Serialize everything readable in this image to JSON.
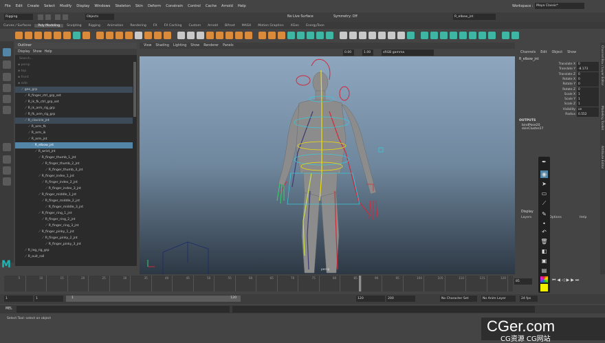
{
  "menu": [
    "File",
    "Edit",
    "Create",
    "Select",
    "Modify",
    "Display",
    "Windows",
    "Skeleton",
    "Skin",
    "Deform",
    "Constrain",
    "Control",
    "Cache",
    "Arnold",
    "Help"
  ],
  "workspace": {
    "label": "Workspace :",
    "value": "Maya Classic*"
  },
  "status": {
    "mode": "Rigging",
    "objects": "Objects",
    "live": "No Live Surface",
    "symmetry": "Symmetry: Off",
    "selected_name": "R_elbow_jnt"
  },
  "shelf_tabs": [
    "Curves / Surfaces",
    "Poly Modeling",
    "Sculpting",
    "Rigging",
    "Animation",
    "Rendering",
    "FX",
    "FX Caching",
    "Custom",
    "Arnold",
    "Bifrost",
    "MASH",
    "Motion Graphics",
    "XGen",
    "EnergyToon"
  ],
  "active_shelf": "Poly Modeling",
  "outliner": {
    "title": "Outliner",
    "menu": [
      "Display",
      "Show",
      "Help"
    ],
    "search": "Search...",
    "rows": [
      {
        "label": "persp",
        "indent": 0,
        "style": "dim"
      },
      {
        "label": "top",
        "indent": 0,
        "style": "dim"
      },
      {
        "label": "front",
        "indent": 0,
        "style": "dim"
      },
      {
        "label": "side",
        "indent": 0,
        "style": "dim"
      },
      {
        "label": "geo_grp",
        "indent": 1,
        "style": "hl"
      },
      {
        "label": "R_finger_ctrl_grp_set",
        "indent": 2,
        "style": ""
      },
      {
        "label": "R_ik_fk_ctrl_grp_set",
        "indent": 2,
        "style": ""
      },
      {
        "label": "R_ik_arm_rig_grp",
        "indent": 2,
        "style": ""
      },
      {
        "label": "R_fk_arm_rig_grp",
        "indent": 2,
        "style": ""
      },
      {
        "label": "R_clavicle_jnt",
        "indent": 2,
        "style": "hl"
      },
      {
        "label": "R_arm_fk",
        "indent": 3,
        "style": ""
      },
      {
        "label": "R_arm_ik",
        "indent": 3,
        "style": ""
      },
      {
        "label": "R_arm_jnt",
        "indent": 3,
        "style": ""
      },
      {
        "label": "R_elbow_jnt",
        "indent": 4,
        "style": "sel"
      },
      {
        "label": "R_wrist_jnt",
        "indent": 5,
        "style": ""
      },
      {
        "label": "R_finger_thumb_1_jnt",
        "indent": 6,
        "style": ""
      },
      {
        "label": "R_finger_thumb_2_jnt",
        "indent": 7,
        "style": ""
      },
      {
        "label": "R_finger_thumb_3_jnt",
        "indent": 8,
        "style": ""
      },
      {
        "label": "R_finger_index_1_jnt",
        "indent": 6,
        "style": ""
      },
      {
        "label": "R_finger_index_2_jnt",
        "indent": 7,
        "style": ""
      },
      {
        "label": "R_finger_index_3_jnt",
        "indent": 8,
        "style": ""
      },
      {
        "label": "R_finger_middle_1_jnt",
        "indent": 6,
        "style": ""
      },
      {
        "label": "R_finger_middle_2_jnt",
        "indent": 7,
        "style": ""
      },
      {
        "label": "R_finger_middle_3_jnt",
        "indent": 8,
        "style": ""
      },
      {
        "label": "R_finger_ring_1_jnt",
        "indent": 6,
        "style": ""
      },
      {
        "label": "R_finger_ring_2_jnt",
        "indent": 7,
        "style": ""
      },
      {
        "label": "R_finger_ring_3_jnt",
        "indent": 8,
        "style": ""
      },
      {
        "label": "R_finger_pinky_1_jnt",
        "indent": 6,
        "style": ""
      },
      {
        "label": "R_finger_pinky_2_jnt",
        "indent": 7,
        "style": ""
      },
      {
        "label": "R_finger_pinky_3_jnt",
        "indent": 8,
        "style": ""
      },
      {
        "label": "R_leg_rig_grp",
        "indent": 2,
        "style": ""
      },
      {
        "label": "R_ouit_roll",
        "indent": 2,
        "style": ""
      }
    ]
  },
  "viewport": {
    "menu": [
      "View",
      "Shading",
      "Lighting",
      "Show",
      "Renderer",
      "Panels"
    ],
    "values": [
      "0.00",
      "1.00"
    ],
    "color_space": "sRGB gamma",
    "camera": "persp"
  },
  "channel_box": {
    "tabs": [
      "Channels",
      "Edit",
      "Object",
      "Show"
    ],
    "node": "R_elbow_jnt",
    "attrs": [
      {
        "name": "Translate X",
        "value": "0"
      },
      {
        "name": "Translate Y",
        "value": "-8.173"
      },
      {
        "name": "Translate Z",
        "value": "0"
      },
      {
        "name": "Rotate X",
        "value": "0"
      },
      {
        "name": "Rotate Y",
        "value": "0"
      },
      {
        "name": "Rotate Z",
        "value": "0"
      },
      {
        "name": "Scale X",
        "value": "1"
      },
      {
        "name": "Scale Y",
        "value": "1"
      },
      {
        "name": "Scale Z",
        "value": "1"
      },
      {
        "name": "Visibility",
        "value": "on"
      },
      {
        "name": "Radius",
        "value": "0.552"
      }
    ],
    "outputs_title": "OUTPUTS",
    "outputs": [
      "bindPose20",
      "skinCluster27"
    ]
  },
  "layers": {
    "title": "Display",
    "menu": [
      "Layers",
      "Options",
      "Help"
    ]
  },
  "side_tabs": [
    "Channel Box / Layer Editor",
    "Modeling Toolkit",
    "Attribute Editor"
  ],
  "timeline": {
    "ticks": [
      "5",
      "10",
      "15",
      "20",
      "25",
      "30",
      "35",
      "40",
      "45",
      "50",
      "55",
      "60",
      "65",
      "70",
      "75",
      "80",
      "85",
      "90",
      "95",
      "100",
      "105",
      "110",
      "115",
      "120"
    ],
    "current": "85"
  },
  "range": {
    "start": "1",
    "inner_start": "1",
    "slider_start": "1",
    "slider_end": "120",
    "end": "120",
    "outer_end": "200",
    "character": "No Character Set",
    "anim_layer": "No Anim Layer",
    "fps": "24 fps"
  },
  "command": {
    "label": "MEL"
  },
  "help_text": "Select Tool: select an object",
  "watermark": {
    "main": "CGer.com",
    "sub": "CG资源 CG网站"
  },
  "colors": {
    "selection": "#5285a6",
    "accent": "#d98a3a",
    "teal": "#3fb5a3"
  }
}
